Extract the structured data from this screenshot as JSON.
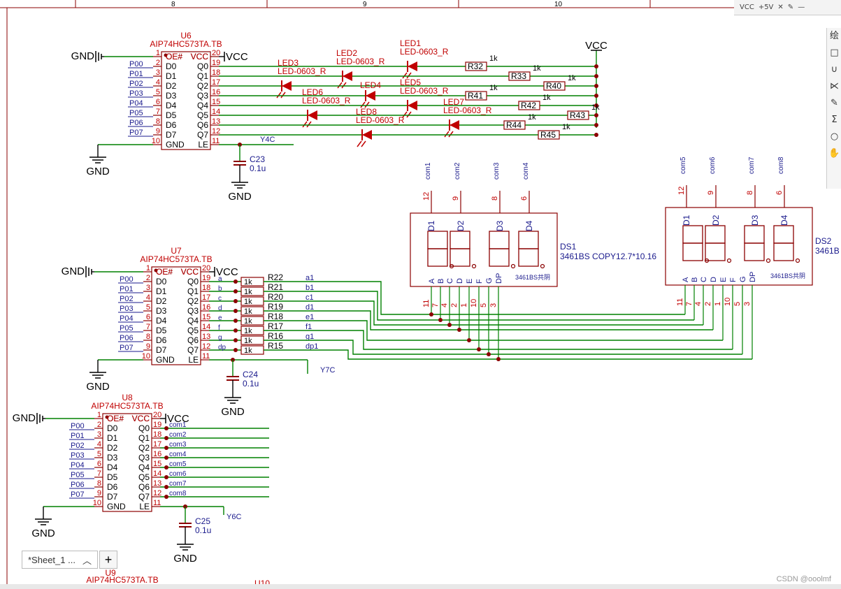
{
  "columns": [
    "8",
    "9",
    "10"
  ],
  "toolbar": {
    "labels": [
      "VCC",
      "+5V"
    ]
  },
  "side_panel": {
    "header": "绘",
    "tools": [
      "□",
      "∪",
      "⋉",
      "✎",
      "Σ",
      "○",
      "✋"
    ]
  },
  "tab": {
    "label": "*Sheet_1 ...",
    "add": "+"
  },
  "watermark": "CSDN @ooolmf",
  "net": {
    "gnd": "GND",
    "vcc": "VCC"
  },
  "chips": {
    "u6": {
      "ref": "U6",
      "part": "AIP74HC573TA.TB",
      "le_net": "Y4C"
    },
    "u7": {
      "ref": "U7",
      "part": "AIP74HC573TA.TB",
      "le_net": "Y7C"
    },
    "u8": {
      "ref": "U8",
      "part": "AIP74HC573TA.TB",
      "le_net": "Y6C"
    },
    "u9": {
      "ref": "U9",
      "part": "AIP74HC573TA.TB"
    },
    "u10": {
      "ref": "U10"
    }
  },
  "ic_pins": {
    "left_names": [
      "OE#",
      "D0",
      "D1",
      "D2",
      "D3",
      "D4",
      "D5",
      "D6",
      "D7",
      "GND"
    ],
    "left_nums": [
      "1",
      "2",
      "3",
      "4",
      "5",
      "6",
      "7",
      "8",
      "9",
      "10"
    ],
    "right_names": [
      "VCC",
      "Q0",
      "Q1",
      "Q2",
      "Q3",
      "Q4",
      "Q5",
      "Q6",
      "Q7",
      "LE"
    ],
    "right_nums": [
      "20",
      "19",
      "18",
      "17",
      "16",
      "15",
      "14",
      "13",
      "12",
      "11"
    ]
  },
  "inputs": [
    "P00",
    "P01",
    "P02",
    "P03",
    "P04",
    "P05",
    "P06",
    "P07"
  ],
  "caps": [
    {
      "ref": "C23",
      "value": "0.1u"
    },
    {
      "ref": "C24",
      "value": "0.1u"
    },
    {
      "ref": "C25",
      "value": "0.1u"
    }
  ],
  "leds": [
    {
      "ref": "LED1",
      "part": "LED-0603_R"
    },
    {
      "ref": "LED2",
      "part": "LED-0603_R"
    },
    {
      "ref": "LED3",
      "part": "LED-0603_R"
    },
    {
      "ref": "LED4",
      "part": ""
    },
    {
      "ref": "LED5",
      "part": "LED-0603_R"
    },
    {
      "ref": "LED6",
      "part": "LED-0603_R"
    },
    {
      "ref": "LED7",
      "part": "LED-0603_R"
    },
    {
      "ref": "LED8",
      "part": "LED-0603_R"
    }
  ],
  "led_resistors": [
    {
      "ref": "R32",
      "value": "1k"
    },
    {
      "ref": "R33",
      "value": "1k"
    },
    {
      "ref": "R40",
      "value": "1k"
    },
    {
      "ref": "R41",
      "value": "1k"
    },
    {
      "ref": "R42",
      "value": "1k"
    },
    {
      "ref": "R43",
      "value": "1k"
    },
    {
      "ref": "R44",
      "value": "1k"
    },
    {
      "ref": "R45",
      "value": "1k"
    }
  ],
  "seg_nets": [
    "a",
    "b",
    "c",
    "d",
    "e",
    "f",
    "g",
    "dp"
  ],
  "seg_resistors": [
    {
      "ref": "R22",
      "value": "1k",
      "net": "a1"
    },
    {
      "ref": "R21",
      "value": "1k",
      "net": "b1"
    },
    {
      "ref": "R20",
      "value": "1k",
      "net": "c1"
    },
    {
      "ref": "R19",
      "value": "1k",
      "net": "d1"
    },
    {
      "ref": "R18",
      "value": "1k",
      "net": "e1"
    },
    {
      "ref": "R17",
      "value": "1k",
      "net": "f1"
    },
    {
      "ref": "R16",
      "value": "1k",
      "net": "g1"
    },
    {
      "ref": "R15",
      "value": "1k",
      "net": "dp1"
    }
  ],
  "com_nets": [
    "com1",
    "com2",
    "com3",
    "com4",
    "com5",
    "com6",
    "com7",
    "com8"
  ],
  "displays": [
    {
      "ref": "DS1",
      "part": "3461BS COPY12.7*10.16",
      "inner": "3461BS共阴",
      "top_nets": [
        "com1",
        "com2",
        "com3",
        "com4"
      ],
      "top_nums": [
        "12",
        "9",
        "8",
        "6"
      ],
      "top_names": [
        "D1",
        "D2",
        "D3",
        "D4"
      ],
      "bottom_names": [
        "A",
        "B",
        "C",
        "D",
        "E",
        "F",
        "G",
        "DP"
      ],
      "bottom_nums": [
        "11",
        "7",
        "4",
        "2",
        "1",
        "10",
        "5",
        "3"
      ]
    },
    {
      "ref": "DS2",
      "part": "3461B",
      "inner": "3461BS共阴",
      "top_nets": [
        "com5",
        "com6",
        "com7",
        "com8"
      ],
      "top_nums": [
        "12",
        "9",
        "8",
        "6"
      ],
      "top_names": [
        "D1",
        "D2",
        "D3",
        "D4"
      ],
      "bottom_names": [
        "A",
        "B",
        "C",
        "D",
        "E",
        "F",
        "G",
        "DP"
      ],
      "bottom_nums": [
        "11",
        "7",
        "4",
        "2",
        "1",
        "10",
        "5",
        "3"
      ]
    }
  ]
}
